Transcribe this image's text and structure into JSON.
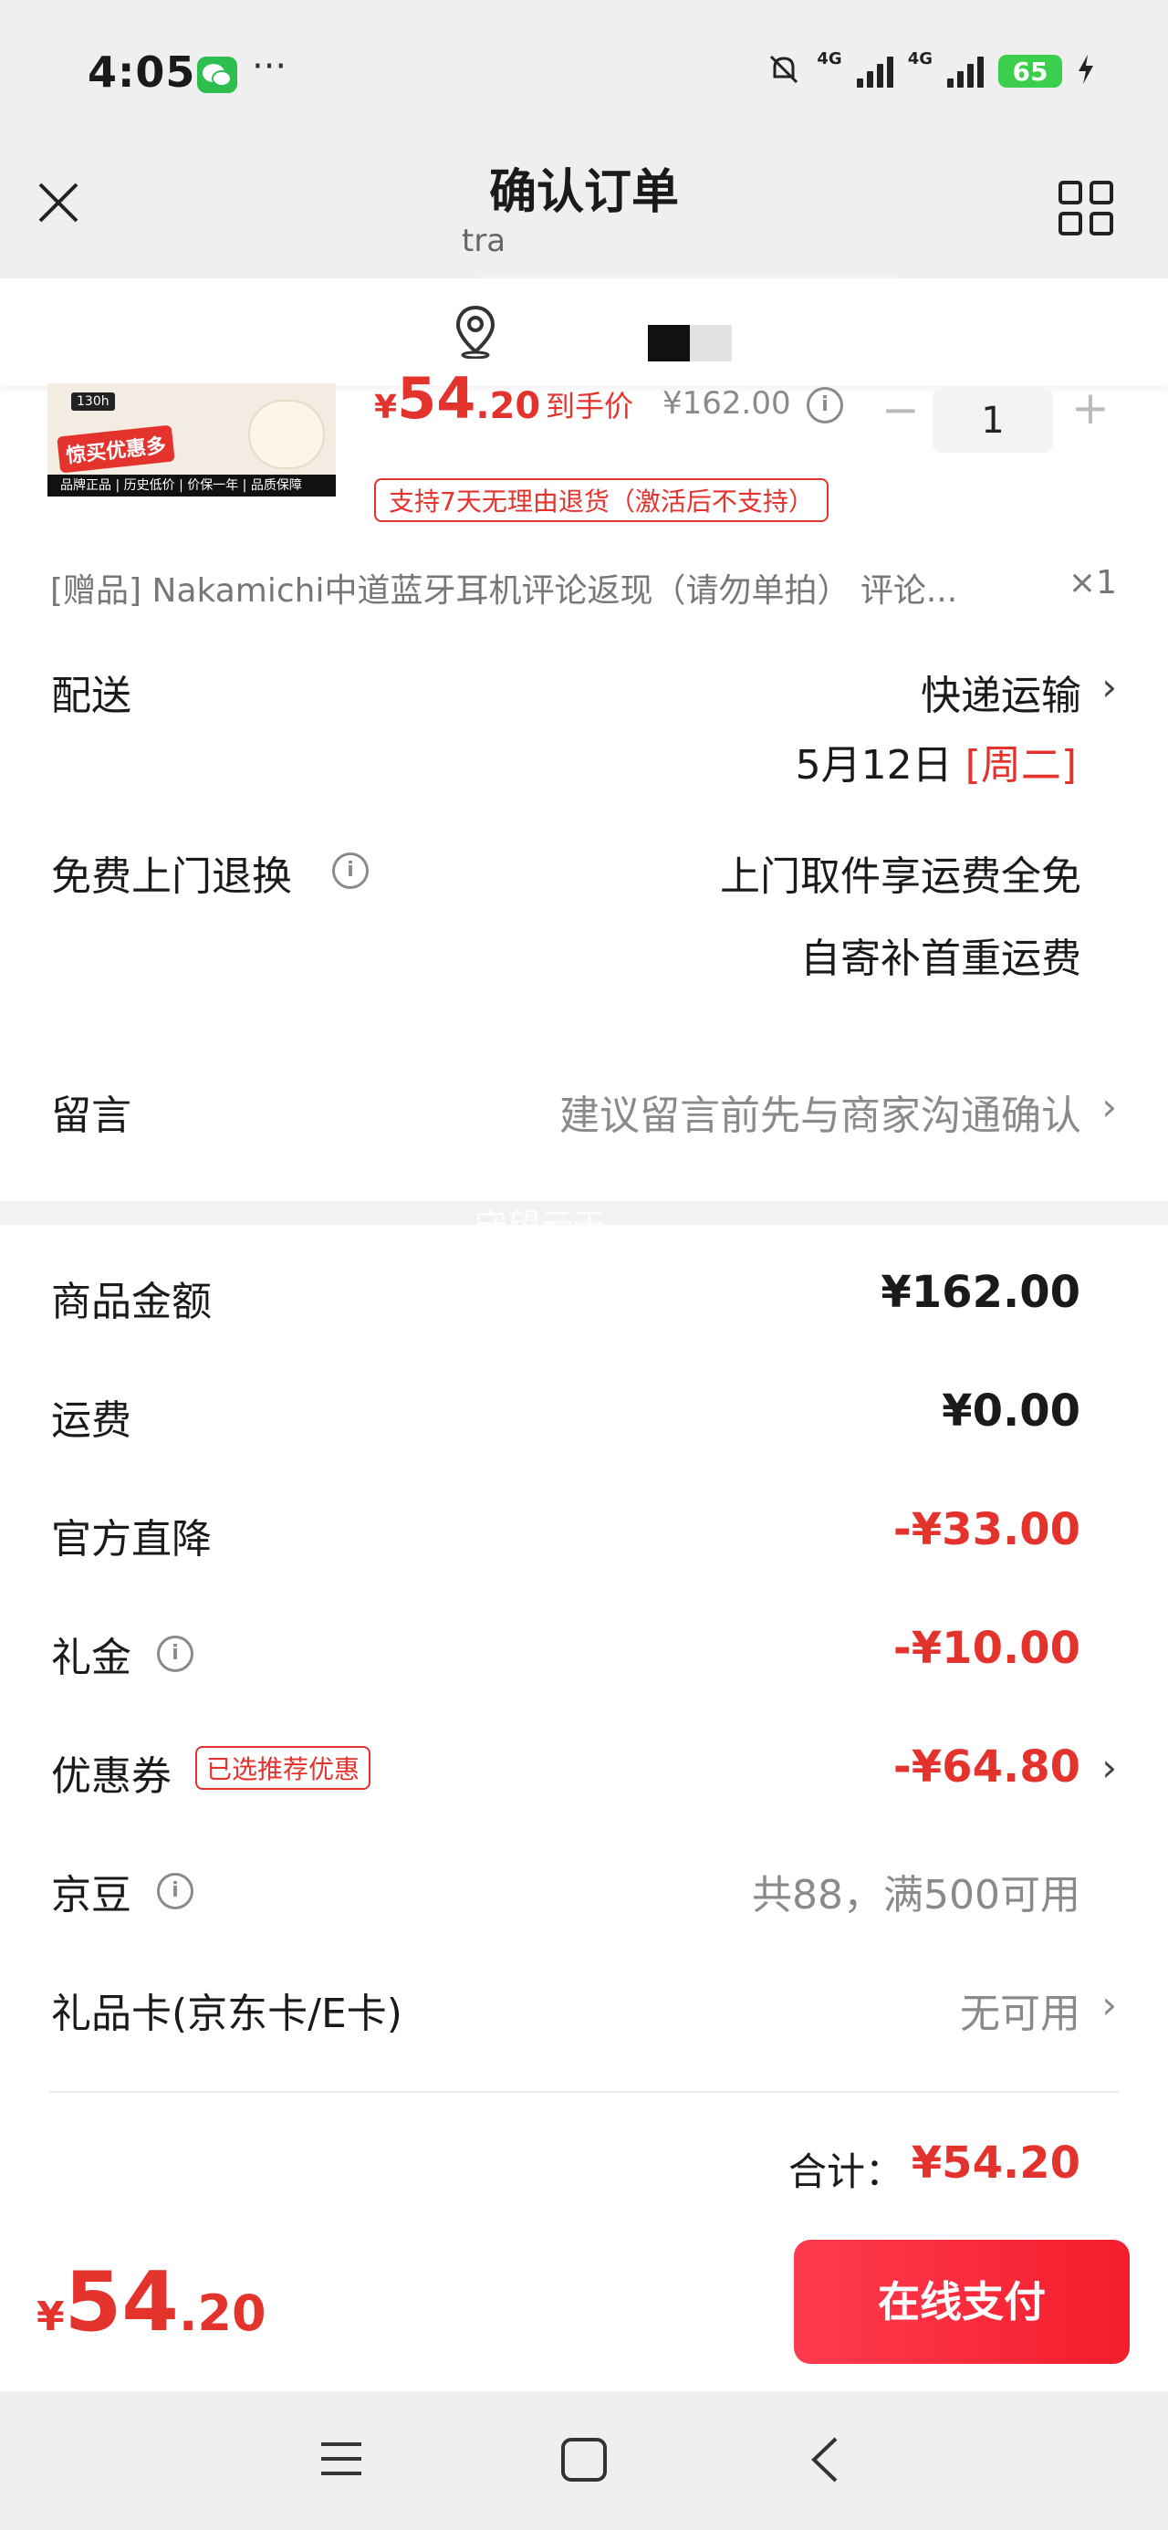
{
  "status_bar": {
    "time": "4:05",
    "dots": "···",
    "network1": "4G",
    "network2": "4G",
    "battery": "65"
  },
  "header": {
    "title": "确认订单",
    "subtitle": "tra"
  },
  "product": {
    "price_symbol": "¥",
    "price_int": "54",
    "price_dec": ".20",
    "price_label": "到手价",
    "original_price": "¥162.00",
    "quantity": "1",
    "return_policy": "支持7天无理由退货（激活后不支持）",
    "image_badge": "130h",
    "image_tag": "惊买优惠多",
    "image_band": "品牌正品 | 历史低价 | 价保一年 | 品质保障"
  },
  "gift": {
    "text": "[赠品] Nakamichi中道蓝牙耳机评论返现（请勿单拍） 评论...",
    "qty": "×1"
  },
  "delivery": {
    "label": "配送",
    "method": "快递运输",
    "date": "5月12日",
    "weekday": "[周二]"
  },
  "free_return": {
    "label": "免费上门退换",
    "line1": "上门取件享运费全免",
    "line2": "自寄补首重运费"
  },
  "message": {
    "label": "留言",
    "placeholder": "建议留言前先与商家沟通确认"
  },
  "watermark": "守望云天",
  "summary": {
    "goods_amount": {
      "label": "商品金额",
      "value": "¥162.00"
    },
    "shipping": {
      "label": "运费",
      "value": "¥0.00"
    },
    "official_discount": {
      "label": "官方直降",
      "value": "-¥33.00"
    },
    "gift_money": {
      "label": "礼金",
      "value": "-¥10.00"
    },
    "coupon": {
      "label": "优惠券",
      "tag": "已选推荐优惠",
      "value": "-¥64.80"
    },
    "jd_beans": {
      "label": "京豆",
      "value": "共88，满500可用"
    },
    "gift_card": {
      "label": "礼品卡(京东卡/E卡)",
      "value": "无可用"
    },
    "total": {
      "label": "合计：",
      "value": "¥54.20"
    }
  },
  "bottom": {
    "price_symbol": "¥",
    "price_int": "54",
    "price_dec": ".20",
    "pay_button": "在线支付"
  },
  "colors": {
    "accent": "#e4322c",
    "pay_button": "#f41d2b",
    "battery": "#3ccf4e",
    "wechat": "#2ebd4f"
  }
}
